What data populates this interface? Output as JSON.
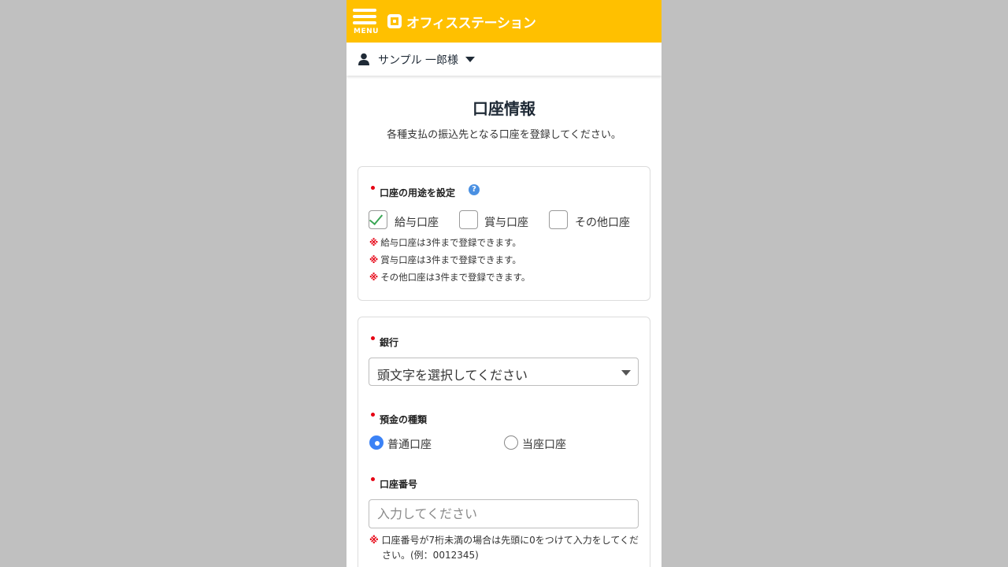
{
  "header": {
    "menu_label": "MENU",
    "brand_name": "オフィスステーション",
    "bg_color": "#ffc000"
  },
  "user": {
    "name": "サンプル 一郎様",
    "icon": "user-icon"
  },
  "page": {
    "title": "口座情報",
    "description": "各種支払の振込先となる口座を登録してください。"
  },
  "usage": {
    "label": "口座の用途を設定",
    "help_icon": "?",
    "options": [
      {
        "label": "給与口座",
        "checked": true
      },
      {
        "label": "賞与口座",
        "checked": false
      },
      {
        "label": "その他口座",
        "checked": false
      }
    ],
    "notes": [
      "給与口座は3件まで登録できます。",
      "賞与口座は3件まで登録できます。",
      "その他口座は3件まで登録できます。"
    ],
    "note_mark": "※"
  },
  "bank": {
    "label": "銀行",
    "select_value": "頭文字を選択してください"
  },
  "deposit_type": {
    "label": "預金の種類",
    "options": [
      {
        "label": "普通口座",
        "selected": true
      },
      {
        "label": "当座口座",
        "selected": false
      }
    ]
  },
  "account_number": {
    "label": "口座番号",
    "placeholder": "入力してください",
    "value": "",
    "note_mark": "※",
    "note": "口座番号が7桁未満の場合は先頭に0をつけて入力をしてください。(例：0012345)"
  },
  "colors": {
    "accent": "#ffc000",
    "required": "#e60012",
    "radio_active": "#3b82f6",
    "check": "#3aa655"
  }
}
